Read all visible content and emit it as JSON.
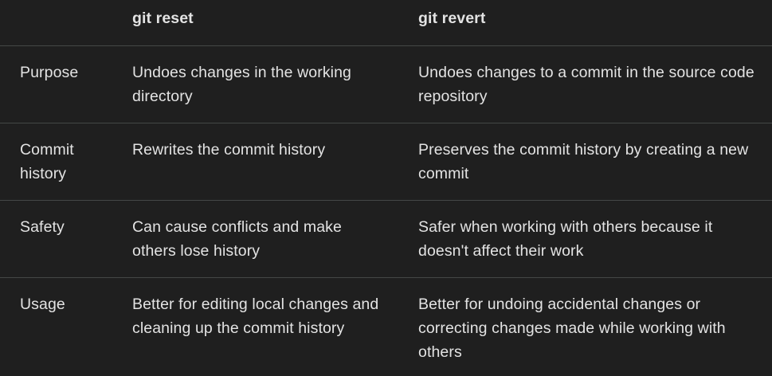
{
  "table": {
    "headers": [
      "",
      "git reset",
      "git revert"
    ],
    "rows": [
      {
        "label": "Purpose",
        "reset": "Undoes changes in the working directory",
        "revert": "Undoes changes to a commit in the source code repository"
      },
      {
        "label": "Commit history",
        "reset": "Rewrites the commit history",
        "revert": "Preserves the commit history by creating a new commit"
      },
      {
        "label": "Safety",
        "reset": "Can cause conflicts and make others lose history",
        "revert": "Safer when working with others because it doesn't affect their work"
      },
      {
        "label": "Usage",
        "reset": "Better for editing local changes and cleaning up the commit history",
        "revert": "Better for undoing accidental changes or correcting changes made while working with others"
      }
    ]
  }
}
